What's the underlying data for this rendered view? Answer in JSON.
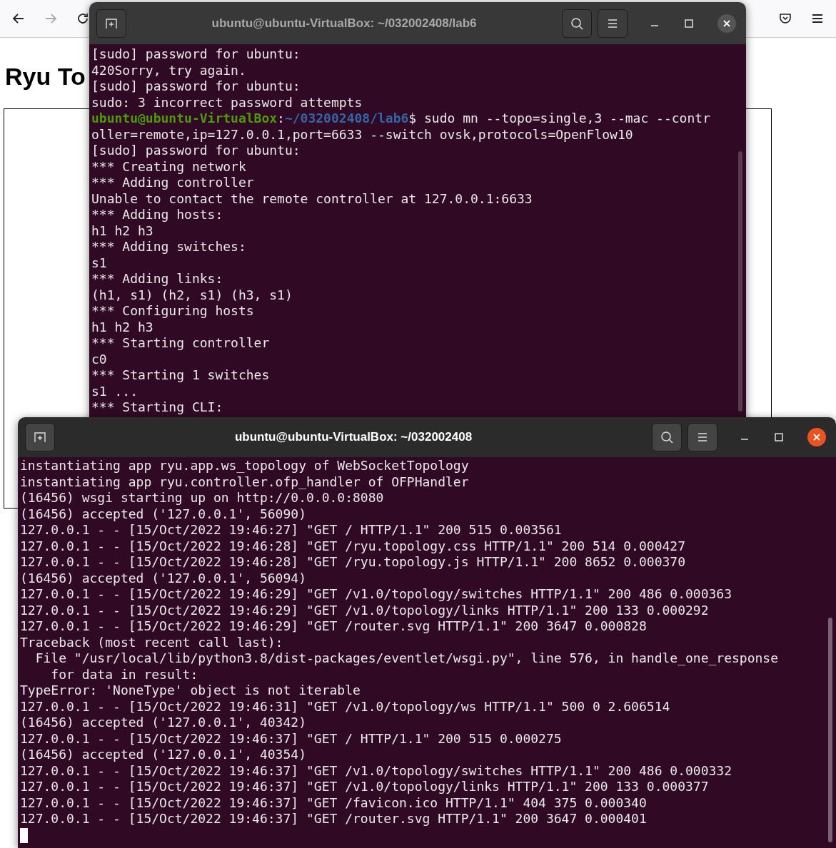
{
  "browser": {
    "heading": "Ryu To",
    "forward_disabled": true
  },
  "windows": [
    {
      "title": "ubuntu@ubuntu-VirtualBox: ~/032002408/lab6",
      "active": false,
      "lines": [
        {
          "kind": "text",
          "text": "[sudo] password for ubuntu:"
        },
        {
          "kind": "text",
          "text": "420Sorry, try again."
        },
        {
          "kind": "text",
          "text": "[sudo] password for ubuntu:"
        },
        {
          "kind": "text",
          "text": "sudo: 3 incorrect password attempts"
        },
        {
          "kind": "prompt",
          "user": "ubuntu@ubuntu-VirtualBox",
          "separator": ":",
          "path": "~/032002408/lab6",
          "command": "$ sudo mn --topo=single,3 --mac --contr"
        },
        {
          "kind": "text",
          "text": "oller=remote,ip=127.0.0.1,port=6633 --switch ovsk,protocols=OpenFlow10"
        },
        {
          "kind": "text",
          "text": "[sudo] password for ubuntu:"
        },
        {
          "kind": "text",
          "text": "*** Creating network"
        },
        {
          "kind": "text",
          "text": "*** Adding controller"
        },
        {
          "kind": "text",
          "text": "Unable to contact the remote controller at 127.0.0.1:6633"
        },
        {
          "kind": "text",
          "text": "*** Adding hosts:"
        },
        {
          "kind": "text",
          "text": "h1 h2 h3"
        },
        {
          "kind": "text",
          "text": "*** Adding switches:"
        },
        {
          "kind": "text",
          "text": "s1"
        },
        {
          "kind": "text",
          "text": "*** Adding links:"
        },
        {
          "kind": "text",
          "text": "(h1, s1) (h2, s1) (h3, s1)"
        },
        {
          "kind": "text",
          "text": "*** Configuring hosts"
        },
        {
          "kind": "text",
          "text": "h1 h2 h3"
        },
        {
          "kind": "text",
          "text": "*** Starting controller"
        },
        {
          "kind": "text",
          "text": "c0"
        },
        {
          "kind": "text",
          "text": "*** Starting 1 switches"
        },
        {
          "kind": "text",
          "text": "s1 ..."
        },
        {
          "kind": "text",
          "text": "*** Starting CLI:"
        }
      ]
    },
    {
      "title": "ubuntu@ubuntu-VirtualBox: ~/032002408",
      "active": true,
      "lines": [
        {
          "kind": "text",
          "text": "instantiating app ryu.app.ws_topology of WebSocketTopology"
        },
        {
          "kind": "text",
          "text": "instantiating app ryu.controller.ofp_handler of OFPHandler"
        },
        {
          "kind": "text",
          "text": "(16456) wsgi starting up on http://0.0.0.0:8080"
        },
        {
          "kind": "text",
          "text": "(16456) accepted ('127.0.0.1', 56090)"
        },
        {
          "kind": "text",
          "text": "127.0.0.1 - - [15/Oct/2022 19:46:27] \"GET / HTTP/1.1\" 200 515 0.003561"
        },
        {
          "kind": "text",
          "text": "127.0.0.1 - - [15/Oct/2022 19:46:28] \"GET /ryu.topology.css HTTP/1.1\" 200 514 0.000427"
        },
        {
          "kind": "text",
          "text": "127.0.0.1 - - [15/Oct/2022 19:46:28] \"GET /ryu.topology.js HTTP/1.1\" 200 8652 0.000370"
        },
        {
          "kind": "text",
          "text": "(16456) accepted ('127.0.0.1', 56094)"
        },
        {
          "kind": "text",
          "text": "127.0.0.1 - - [15/Oct/2022 19:46:29] \"GET /v1.0/topology/switches HTTP/1.1\" 200 486 0.000363"
        },
        {
          "kind": "text",
          "text": "127.0.0.1 - - [15/Oct/2022 19:46:29] \"GET /v1.0/topology/links HTTP/1.1\" 200 133 0.000292"
        },
        {
          "kind": "text",
          "text": "127.0.0.1 - - [15/Oct/2022 19:46:29] \"GET /router.svg HTTP/1.1\" 200 3647 0.000828"
        },
        {
          "kind": "text",
          "text": "Traceback (most recent call last):"
        },
        {
          "kind": "text",
          "text": "  File \"/usr/local/lib/python3.8/dist-packages/eventlet/wsgi.py\", line 576, in handle_one_response"
        },
        {
          "kind": "text",
          "text": "    for data in result:"
        },
        {
          "kind": "text",
          "text": "TypeError: 'NoneType' object is not iterable"
        },
        {
          "kind": "text",
          "text": "127.0.0.1 - - [15/Oct/2022 19:46:31] \"GET /v1.0/topology/ws HTTP/1.1\" 500 0 2.606514"
        },
        {
          "kind": "text",
          "text": "(16456) accepted ('127.0.0.1', 40342)"
        },
        {
          "kind": "text",
          "text": "127.0.0.1 - - [15/Oct/2022 19:46:37] \"GET / HTTP/1.1\" 200 515 0.000275"
        },
        {
          "kind": "text",
          "text": "(16456) accepted ('127.0.0.1', 40354)"
        },
        {
          "kind": "text",
          "text": "127.0.0.1 - - [15/Oct/2022 19:46:37] \"GET /v1.0/topology/switches HTTP/1.1\" 200 486 0.000332"
        },
        {
          "kind": "text",
          "text": "127.0.0.1 - - [15/Oct/2022 19:46:37] \"GET /v1.0/topology/links HTTP/1.1\" 200 133 0.000377"
        },
        {
          "kind": "text",
          "text": "127.0.0.1 - - [15/Oct/2022 19:46:37] \"GET /favicon.ico HTTP/1.1\" 404 375 0.000340"
        },
        {
          "kind": "text",
          "text": "127.0.0.1 - - [15/Oct/2022 19:46:37] \"GET /router.svg HTTP/1.1\" 200 3647 0.000401"
        },
        {
          "kind": "cursor"
        }
      ]
    }
  ]
}
